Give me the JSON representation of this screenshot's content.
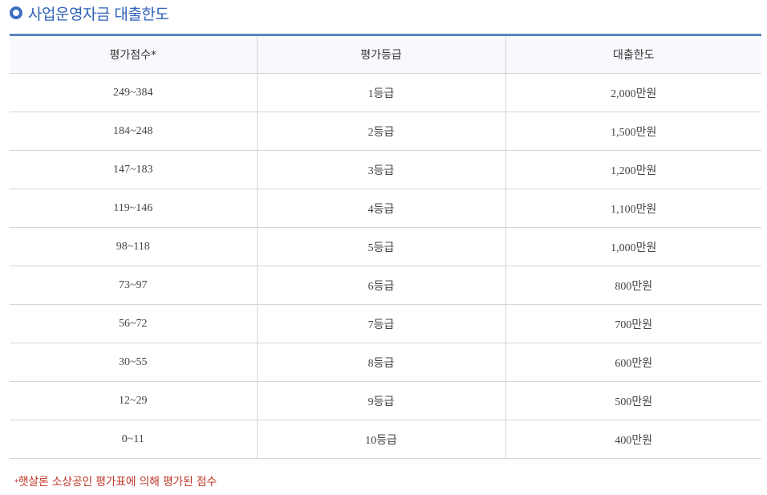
{
  "title": "사업운영자금 대출한도",
  "table": {
    "headers": [
      "평가점수*",
      "평가등급",
      "대출한도"
    ],
    "rows": [
      [
        "249~384",
        "1등급",
        "2,000만원"
      ],
      [
        "184~248",
        "2등급",
        "1,500만원"
      ],
      [
        "147~183",
        "3등급",
        "1,200만원"
      ],
      [
        "119~146",
        "4등급",
        "1,100만원"
      ],
      [
        "98~118",
        "5등급",
        "1,000만원"
      ],
      [
        "73~97",
        "6등급",
        "800만원"
      ],
      [
        "56~72",
        "7등급",
        "700만원"
      ],
      [
        "30~55",
        "8등급",
        "600만원"
      ],
      [
        "12~29",
        "9등급",
        "500만원"
      ],
      [
        "0~11",
        "10등급",
        "400만원"
      ]
    ]
  },
  "footnote": {
    "mark": "*",
    "text": "햇살론 소상공인 평가표에 의해 평가된 점수"
  },
  "colors": {
    "title": "#2f62b8",
    "table_top_border": "#5b84c4",
    "footnote": "#c0392b"
  },
  "icons": {
    "title_bullet": "circle-bullet-icon"
  }
}
